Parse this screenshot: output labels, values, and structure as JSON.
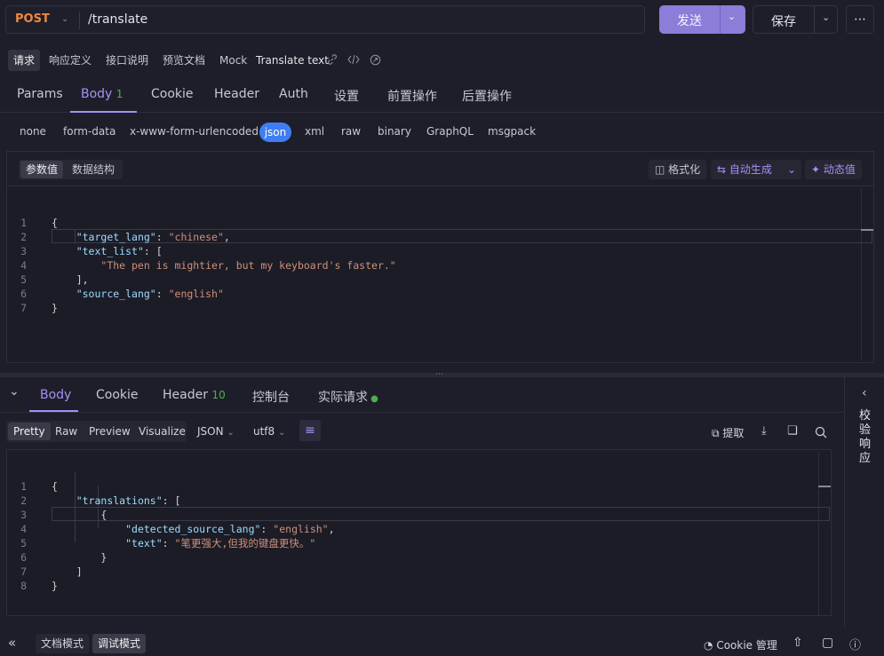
{
  "request": {
    "method": "POST",
    "url": "/translate"
  },
  "actions": {
    "send": "发送",
    "save": "保存",
    "more": "⋯"
  },
  "subtabs": [
    "请求",
    "响应定义",
    "接口说明",
    "预览文档",
    "Mock"
  ],
  "api_name": "Translate text",
  "req_tabs": [
    "Params",
    "Body",
    "Cookie",
    "Header",
    "Auth",
    "设置",
    "前置操作",
    "后置操作"
  ],
  "body_count": "1",
  "body_types": [
    "none",
    "form-data",
    "x-www-form-urlencoded",
    "json",
    "xml",
    "raw",
    "binary",
    "GraphQL",
    "msgpack"
  ],
  "editor_tabs": [
    "参数值",
    "数据结构"
  ],
  "editor_actions": {
    "format": "格式化",
    "autogen": "自动生成",
    "dynamic": "动态值"
  },
  "request_code": [
    {
      "n": "1",
      "t": "{"
    },
    {
      "n": "2",
      "t": "    \"target_lang\": \"chinese\","
    },
    {
      "n": "3",
      "t": "    \"text_list\": ["
    },
    {
      "n": "4",
      "t": "        \"The pen is mightier, but my keyboard's faster.\""
    },
    {
      "n": "5",
      "t": "    ],"
    },
    {
      "n": "6",
      "t": "    \"source_lang\": \"english\""
    },
    {
      "n": "7",
      "t": "}"
    }
  ],
  "resp_tabs": [
    "Body",
    "Cookie",
    "Header",
    "控制台",
    "实际请求"
  ],
  "header_count": "10",
  "view_modes": [
    "Pretty",
    "Raw",
    "Preview",
    "Visualize"
  ],
  "format_select": "JSON",
  "encoding_select": "utf8",
  "extract": "提取",
  "response_code": [
    {
      "n": "1",
      "t": "{"
    },
    {
      "n": "2",
      "t": "    \"translations\": ["
    },
    {
      "n": "3",
      "t": "        {"
    },
    {
      "n": "4",
      "t": "            \"detected_source_lang\": \"english\","
    },
    {
      "n": "5",
      "t": "            \"text\": \"笔更强大,但我的键盘更快。\""
    },
    {
      "n": "6",
      "t": "        }"
    },
    {
      "n": "7",
      "t": "    ]"
    },
    {
      "n": "8",
      "t": "}"
    }
  ],
  "side_panel": "校验响应",
  "footer": {
    "doc_mode": "文档模式",
    "debug_mode": "调试模式",
    "cookie": "Cookie 管理"
  },
  "colors": {
    "accent": "#a491f5",
    "send": "#8c7dd9",
    "json_pill": "#3e7ef2",
    "method": "#f0883e",
    "count": "#4caf50"
  }
}
